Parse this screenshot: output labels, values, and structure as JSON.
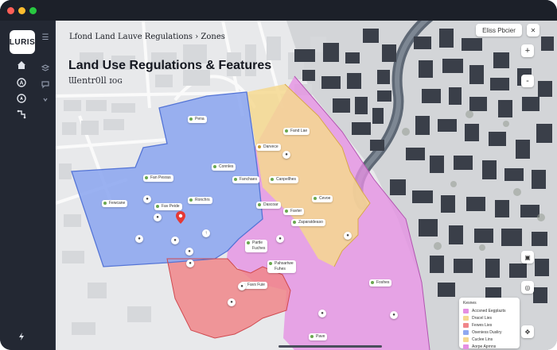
{
  "app": {
    "logo_text": "LURIS",
    "window_controls": {
      "close_color": "#ff5f57",
      "minimize_color": "#febc2e",
      "maximize_color": "#28c840"
    }
  },
  "sidebar": {
    "items": [
      {
        "icon": "home-icon"
      },
      {
        "icon": "user-icon"
      },
      {
        "icon": "compass-icon"
      },
      {
        "icon": "route-icon"
      }
    ],
    "secondary_items": [
      {
        "icon": "layers-icon"
      },
      {
        "icon": "chat-icon"
      },
      {
        "icon": "chevron-icon"
      }
    ],
    "bottom_icon": "lightning-icon"
  },
  "header": {
    "breadcrumb": "Lfond Land Lauve Regulations › Zones",
    "title": "Land Use Regulations & Features",
    "subtitle": "Ɯentr0ll ɪoɢ"
  },
  "map_controls": {
    "search_label": "Eliss Pbcier",
    "zoom_in": "+",
    "zoom_out": "-"
  },
  "zones": [
    {
      "name": "blue",
      "color": "#8fa8f0"
    },
    {
      "name": "yellow",
      "color": "#f5d88f"
    },
    {
      "name": "pink",
      "color": "#e58fe3"
    },
    {
      "name": "red",
      "color": "#f0868a"
    }
  ],
  "labels": [
    {
      "text": "Pena",
      "color": "#4a8c5a"
    },
    {
      "text": "Fand Lae",
      "color": "#4a8c5a"
    },
    {
      "text": "Darvece",
      "color": "#c99a2e"
    },
    {
      "text": "Connles",
      "color": "#4a8c5a"
    },
    {
      "text": "Fan Pesras",
      "color": "#4a8c5a"
    },
    {
      "text": "Fanchaes",
      "color": "#4a8c5a"
    },
    {
      "text": "Canpellhes",
      "color": "#4a8c5a"
    },
    {
      "text": "Fewcane",
      "color": "#4a8c5a"
    },
    {
      "text": "Fav Peide",
      "color": "#4a8c5a"
    },
    {
      "text": "Ronchrs",
      "color": "#4a8c5a"
    },
    {
      "text": "Cevoe",
      "color": "#4a8c5a"
    },
    {
      "text": "Dascoar",
      "color": "#4a8c5a"
    },
    {
      "text": "Favter",
      "color": "#4a8c5a"
    },
    {
      "text": "Zaparatdeaso",
      "color": "#4a8c5a"
    },
    {
      "text": "Partle\nFuches",
      "color": "#4a8c5a"
    },
    {
      "text": "Pahsartwe\nFuhes",
      "color": "#4a8c5a"
    },
    {
      "text": "Favs Fuie",
      "color": "#4a8c5a"
    },
    {
      "text": "Foshes",
      "color": "#4a8c5a"
    },
    {
      "text": "Pave",
      "color": "#4a8c5a"
    }
  ],
  "legend": {
    "title": "Kesnes",
    "items": [
      {
        "label": "Accsned Eegplazts",
        "color": "#e58fe3"
      },
      {
        "label": "Dracel Lies",
        "color": "#f5d88f"
      },
      {
        "label": "Fewes Lies",
        "color": "#f0868a"
      },
      {
        "label": "Oseniess Dusliry",
        "color": "#8fa8f0"
      },
      {
        "label": "Cuclee Lins",
        "color": "#f5d88f"
      },
      {
        "label": "Aorpe Aprnns",
        "color": "#e58fe3"
      }
    ]
  }
}
